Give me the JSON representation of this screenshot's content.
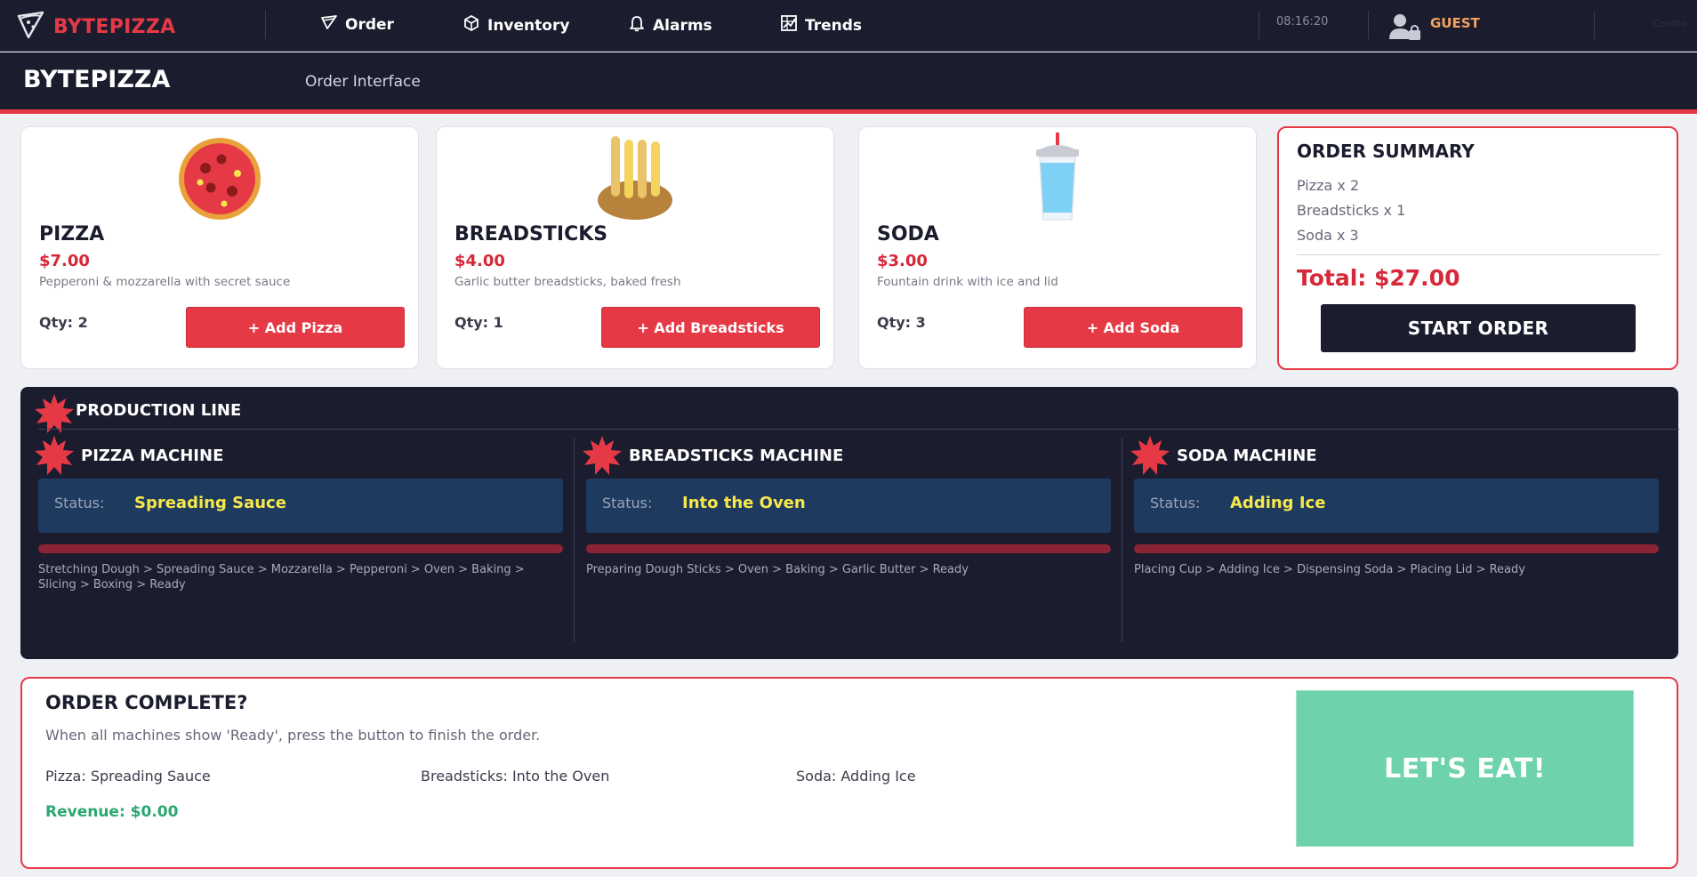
{
  "colors": {
    "brand": "#e63946",
    "navy": "#1b1c2e",
    "status_bg": "#1e3a5f",
    "status_text": "#f7e84a",
    "revenue": "#2aa86f",
    "eat_button": "#6ed3ad",
    "user": "#f4a261"
  },
  "nav": {
    "brand": "BYTEPIZZA",
    "brand_icon": "pizza-slice-icon",
    "items": [
      {
        "label": "Order",
        "icon": "pizza-slice-icon"
      },
      {
        "label": "Inventory",
        "icon": "box-icon"
      },
      {
        "label": "Alarms",
        "icon": "bell-icon"
      },
      {
        "label": "Trends",
        "icon": "chart-grid-icon"
      }
    ],
    "time": "08:16:20",
    "user": "GUEST",
    "user_icon": "user-lock-icon",
    "combo": "Combo"
  },
  "header": {
    "title": "BYTEPIZZA",
    "subtitle": "Order Interface"
  },
  "products": [
    {
      "name": "PIZZA",
      "price": "$7.00",
      "desc": "Pepperoni & mozzarella with secret sauce",
      "qty": "Qty: 2",
      "button": "+ Add Pizza",
      "icon": "pizza-icon"
    },
    {
      "name": "BREADSTICKS",
      "price": "$4.00",
      "desc": "Garlic butter breadsticks, baked fresh",
      "qty": "Qty: 1",
      "button": "+ Add Breadsticks",
      "icon": "breadsticks-icon"
    },
    {
      "name": "SODA",
      "price": "$3.00",
      "desc": "Fountain drink with ice and lid",
      "qty": "Qty: 3",
      "button": "+ Add Soda",
      "icon": "soda-cup-icon"
    }
  ],
  "summary": {
    "title": "ORDER SUMMARY",
    "lines": [
      "Pizza  x 2",
      "Breadsticks  x 1",
      "Soda  x 3"
    ],
    "total": "Total: $27.00",
    "button": "START ORDER"
  },
  "production": {
    "title": "PRODUCTION LINE",
    "status_label": "Status:",
    "machines": [
      {
        "name": "PIZZA MACHINE",
        "status": "Spreading Sauce",
        "steps": "Stretching Dough > Spreading Sauce > Mozzarella > Pepperoni > Oven > Baking > Slicing > Boxing > Ready"
      },
      {
        "name": "BREADSTICKS MACHINE",
        "status": "Into the Oven",
        "steps": "Preparing Dough Sticks > Oven > Baking > Garlic Butter > Ready"
      },
      {
        "name": "SODA MACHINE",
        "status": "Adding Ice",
        "steps": "Placing Cup > Adding Ice > Dispensing Soda > Placing Lid > Ready"
      }
    ]
  },
  "complete": {
    "title": "ORDER COMPLETE?",
    "desc": "When all machines show 'Ready', press the button to finish the order.",
    "pizza": "Pizza: Spreading Sauce",
    "breadsticks": "Breadsticks: Into the Oven",
    "soda": "Soda: Adding Ice",
    "revenue": "Revenue: $0.00",
    "button": "LET'S EAT!"
  }
}
